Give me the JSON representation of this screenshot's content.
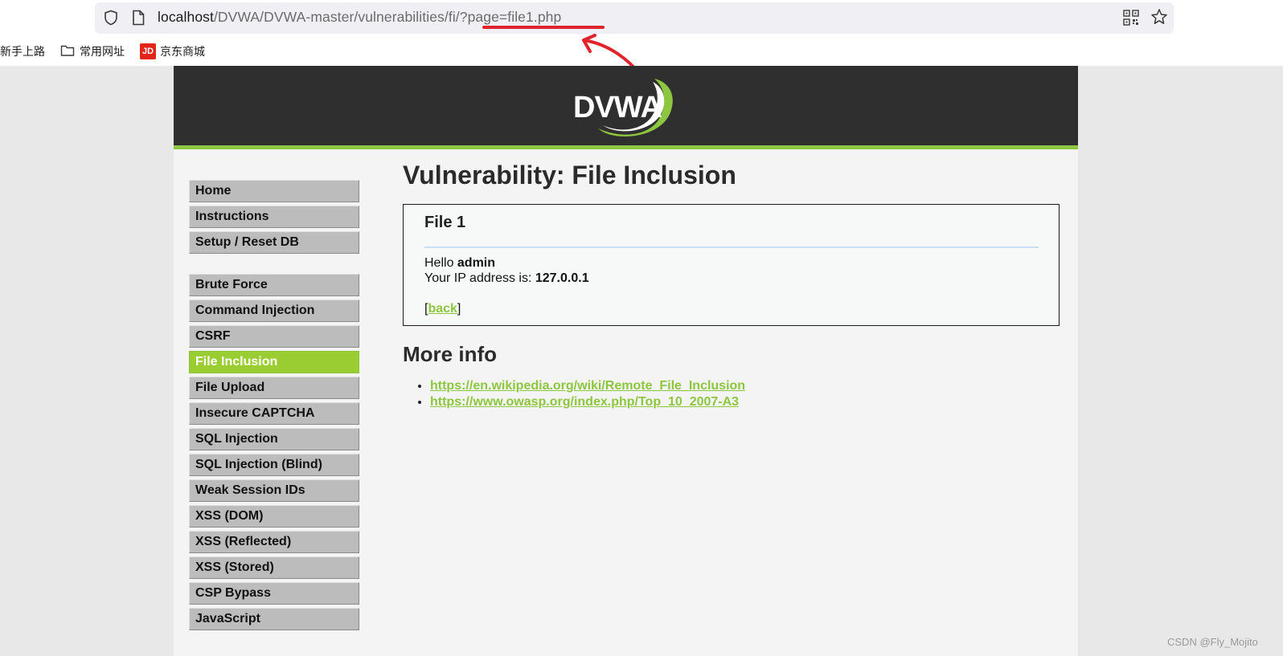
{
  "browser": {
    "url_host": "localhost",
    "url_path": "/DVWA/DVWA-master/vulnerabilities/fi/?page=file1.php",
    "bookmarks": [
      "新手上路",
      "常用网址",
      "京东商城"
    ],
    "jd_icon_text": "JD"
  },
  "header": {
    "logo_text": "DVWA"
  },
  "menu": {
    "group1": [
      "Home",
      "Instructions",
      "Setup / Reset DB"
    ],
    "group2": [
      "Brute Force",
      "Command Injection",
      "CSRF",
      "File Inclusion",
      "File Upload",
      "Insecure CAPTCHA",
      "SQL Injection",
      "SQL Injection (Blind)",
      "Weak Session IDs",
      "XSS (DOM)",
      "XSS (Reflected)",
      "XSS (Stored)",
      "CSP Bypass",
      "JavaScript"
    ],
    "active": "File Inclusion"
  },
  "main": {
    "title": "Vulnerability: File Inclusion",
    "box": {
      "heading": "File 1",
      "hello_prefix": "Hello ",
      "user": "admin",
      "ip_prefix": "Your IP address is: ",
      "ip": "127.0.0.1",
      "bracket_open": "[",
      "back_label": "back",
      "bracket_close": "]"
    },
    "more_info_title": "More info",
    "links": [
      "https://en.wikipedia.org/wiki/Remote_File_Inclusion",
      "https://www.owasp.org/index.php/Top_10_2007-A3"
    ]
  },
  "watermark": "CSDN @Fly_Mojito",
  "colors": {
    "accent_green": "#8dc63f",
    "menu_active": "#9acd32",
    "header_bg": "#2f2f2f",
    "annotation_red": "#e0242c"
  }
}
